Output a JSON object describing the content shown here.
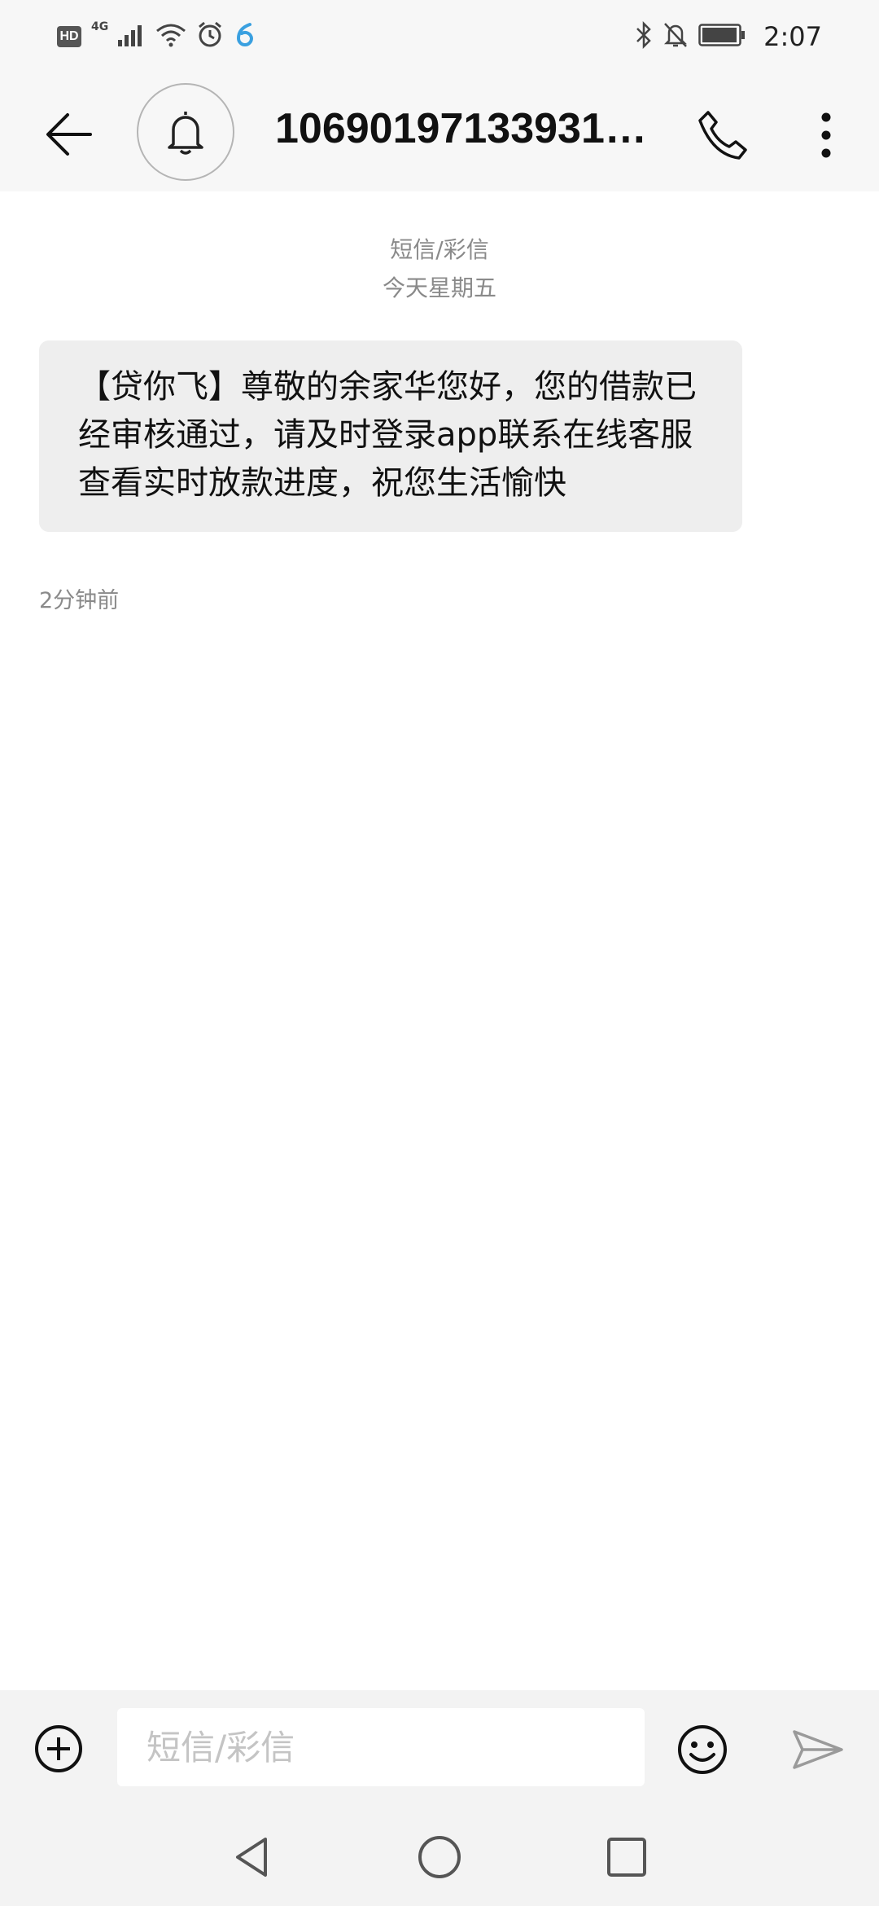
{
  "status_bar": {
    "hd": "HD",
    "network": "4G",
    "time": "2:07",
    "icons": [
      "signal-icon",
      "wifi-icon",
      "alarm-icon",
      "app-notification-icon",
      "bluetooth-icon",
      "mute-icon",
      "battery-icon"
    ]
  },
  "header": {
    "contact": "10690197133931…",
    "icons": [
      "back-arrow-icon",
      "bell-icon",
      "phone-icon",
      "more-vertical-icon"
    ]
  },
  "conversation": {
    "type_label": "短信/彩信",
    "date_label": "今天星期五",
    "messages": [
      {
        "text": "【贷你飞】尊敬的余家华您好，您的借款已经审核通过，请及时登录app联系在线客服查看实时放款进度，祝您生活愉快",
        "time": "2分钟前"
      }
    ]
  },
  "composer": {
    "placeholder": "短信/彩信",
    "value": "",
    "icons": [
      "add-circle-icon",
      "emoji-icon",
      "send-icon"
    ]
  },
  "nav_bar": {
    "icons": [
      "nav-back-icon",
      "nav-home-icon",
      "nav-recent-icon"
    ]
  },
  "colors": {
    "bar_bg": "#f7f7f7",
    "bubble_bg": "#eeeeee",
    "meta_text": "#8a8a8a",
    "placeholder": "#c4c4c4"
  }
}
